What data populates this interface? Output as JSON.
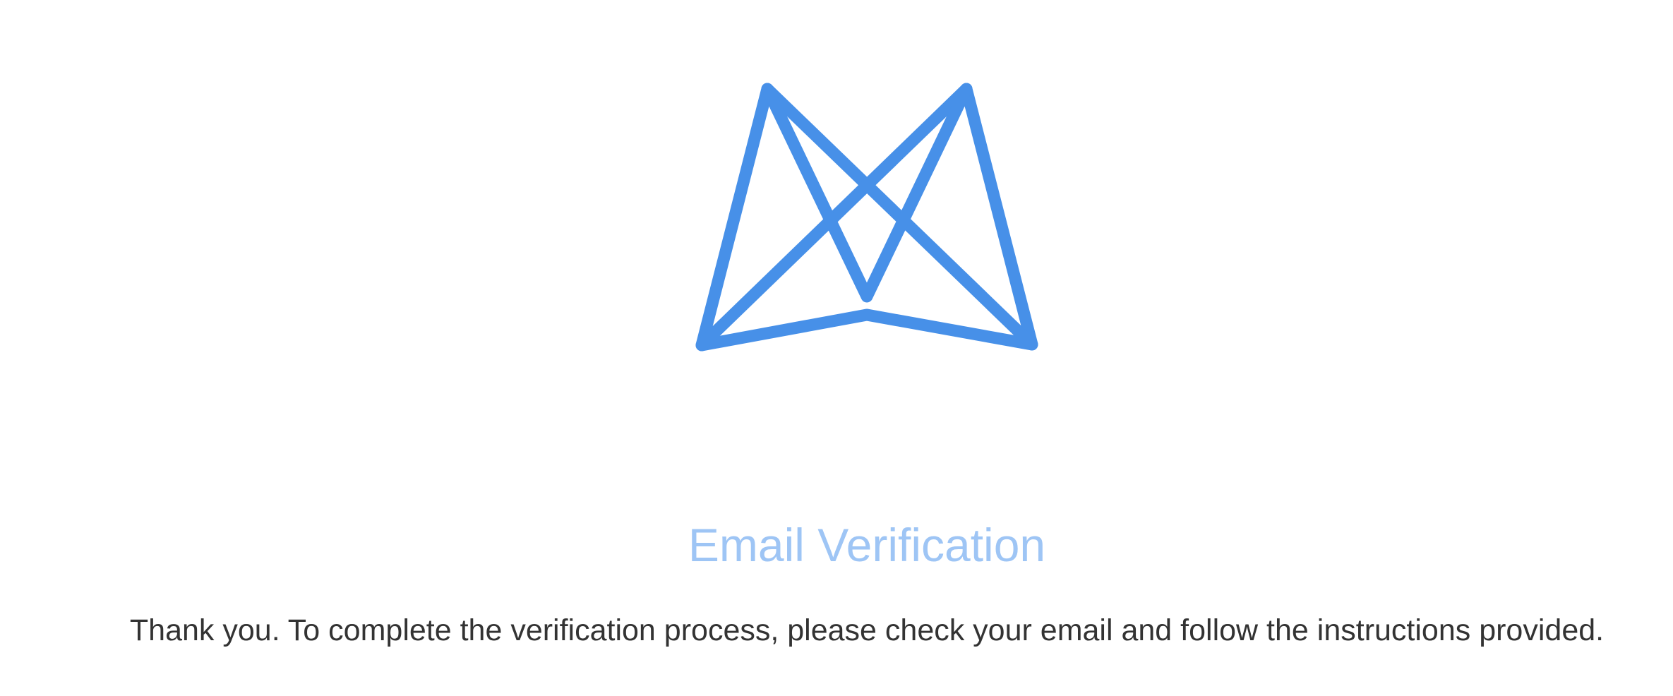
{
  "logo": {
    "name": "brand-logo",
    "color": "#4790e8"
  },
  "heading": "Email Verification",
  "heading_color": "#9ec5f5",
  "message": "Thank you. To complete the verification process, please check your email and follow the instructions provided."
}
